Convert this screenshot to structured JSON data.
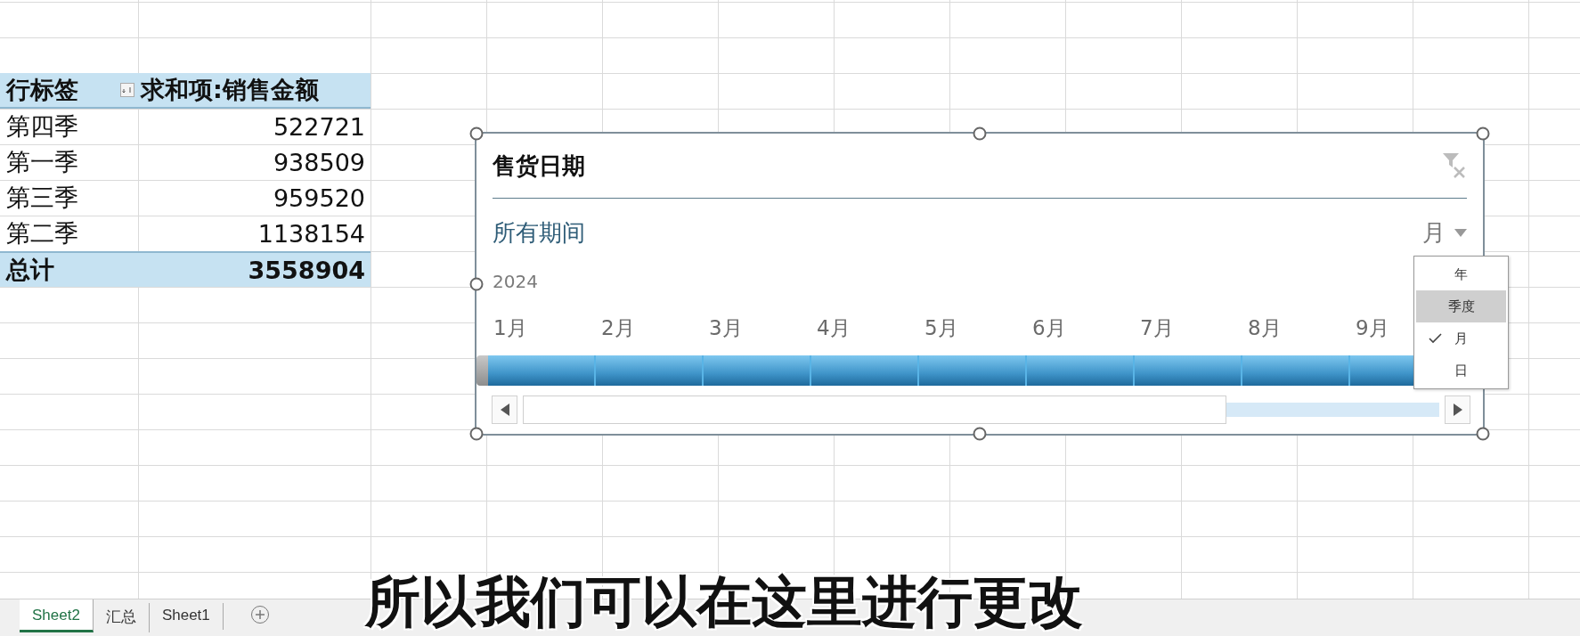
{
  "pivot": {
    "columns": [
      "行标签",
      "求和项:销售金额"
    ],
    "rows": [
      {
        "label": "第四季",
        "value": "522721"
      },
      {
        "label": "第一季",
        "value": "938509"
      },
      {
        "label": "第三季",
        "value": "959520"
      },
      {
        "label": "第二季",
        "value": "1138154"
      }
    ],
    "total": {
      "label": "总计",
      "value": "3558904"
    }
  },
  "timeline": {
    "title": "售货日期",
    "period": "所有期间",
    "level_button": "月",
    "year": "2024",
    "months": [
      "1月",
      "2月",
      "3月",
      "4月",
      "5月",
      "6月",
      "7月",
      "8月",
      "9月"
    ],
    "level_menu": [
      {
        "label": "年",
        "selected": false,
        "checked": false
      },
      {
        "label": "季度",
        "selected": true,
        "checked": false
      },
      {
        "label": "月",
        "selected": false,
        "checked": true
      },
      {
        "label": "日",
        "selected": false,
        "checked": false
      }
    ]
  },
  "sheet_tabs": [
    {
      "label": "Sheet2",
      "selected": true
    },
    {
      "label": "汇总",
      "selected": false
    },
    {
      "label": "Sheet1",
      "selected": false
    }
  ],
  "caption": "所以我们可以在这里进行更改"
}
